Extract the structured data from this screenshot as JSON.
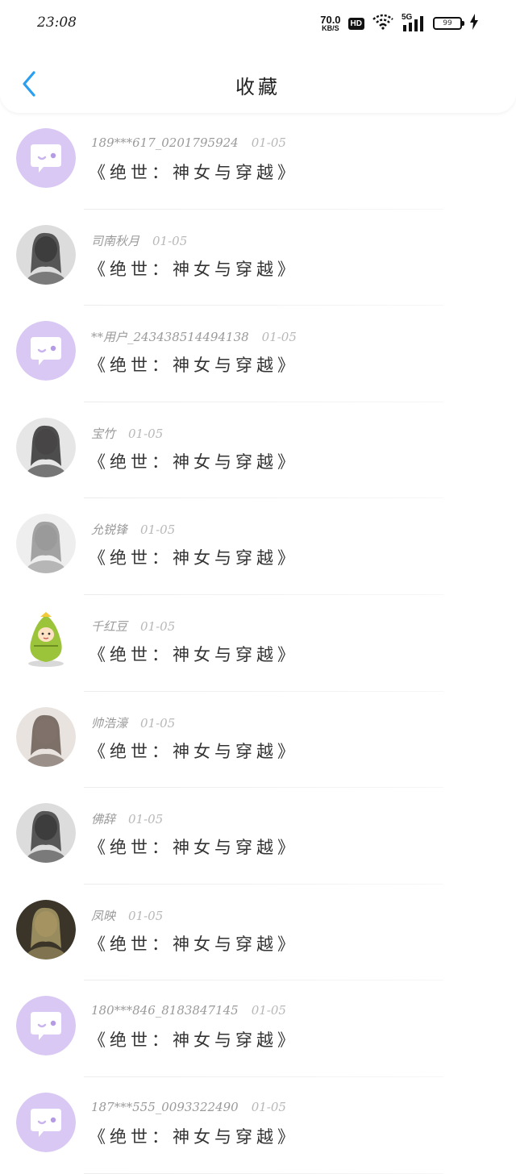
{
  "status_bar": {
    "time": "23:08",
    "net_speed_value": "70.0",
    "net_speed_unit": "KB/S",
    "hd_label": "HD",
    "signal_label": "5G",
    "battery_level": "99"
  },
  "header": {
    "title": "收藏"
  },
  "colors": {
    "accent": "#2a9ff0",
    "default_avatar_bg": "#d9c8f4",
    "name_text": "#9a9a9a",
    "title_text": "#333333"
  },
  "items": [
    {
      "user": "189***617_0201795924",
      "date": "01-05",
      "title": "《绝世：神女与穿越》",
      "avatar": "default-chat-avatar"
    },
    {
      "user": "司南秋月",
      "date": "01-05",
      "title": "《绝世：神女与穿越》",
      "avatar": "photo-avatar"
    },
    {
      "user": "**用户_243438514494138",
      "date": "01-05",
      "title": "《绝世：神女与穿越》",
      "avatar": "default-chat-avatar"
    },
    {
      "user": "宝竹",
      "date": "01-05",
      "title": "《绝世：神女与穿越》",
      "avatar": "photo-avatar"
    },
    {
      "user": "允锐锋",
      "date": "01-05",
      "title": "《绝世：神女与穿越》",
      "avatar": "photo-avatar"
    },
    {
      "user": "千红豆",
      "date": "01-05",
      "title": "《绝世：神女与穿越》",
      "avatar": "cartoon-avatar"
    },
    {
      "user": "帅浩濠",
      "date": "01-05",
      "title": "《绝世：神女与穿越》",
      "avatar": "photo-avatar"
    },
    {
      "user": "佛辞",
      "date": "01-05",
      "title": "《绝世：神女与穿越》",
      "avatar": "photo-avatar"
    },
    {
      "user": "凤映",
      "date": "01-05",
      "title": "《绝世：神女与穿越》",
      "avatar": "photo-avatar"
    },
    {
      "user": "180***846_8183847145",
      "date": "01-05",
      "title": "《绝世：神女与穿越》",
      "avatar": "default-chat-avatar"
    },
    {
      "user": "187***555_0093322490",
      "date": "01-05",
      "title": "《绝世：神女与穿越》",
      "avatar": "default-chat-avatar"
    }
  ]
}
